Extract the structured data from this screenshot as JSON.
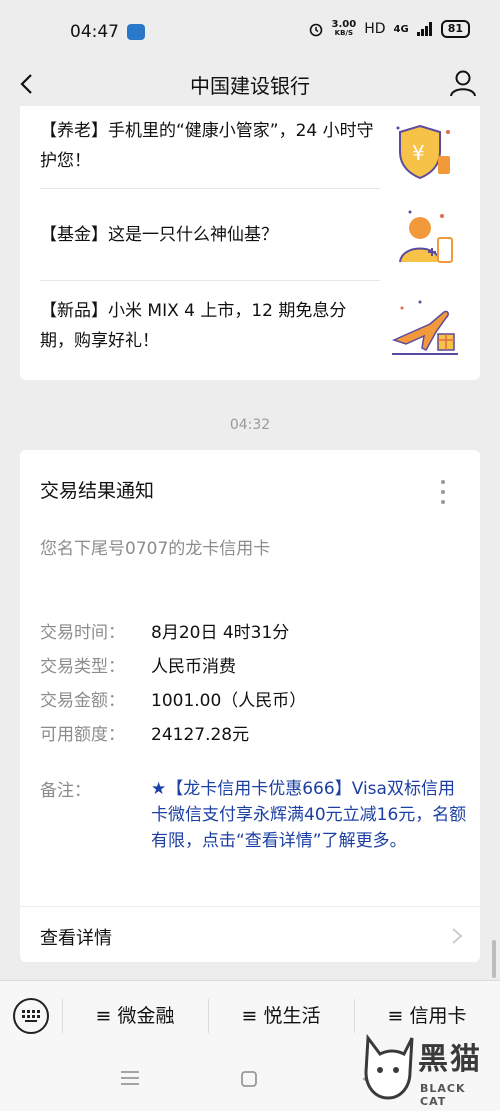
{
  "status_bar": {
    "time": "04:47",
    "speed": "3.00",
    "speed_unit": "KB/S",
    "hd": "HD",
    "network": "4G",
    "battery": "81"
  },
  "header": {
    "title": "中国建设银行"
  },
  "news": [
    {
      "text": "【养老】手机里的“健康小管家”，24 小时守护您！",
      "icon": "pension-shield-icon"
    },
    {
      "text": "【基金】这是一只什么神仙基？",
      "icon": "fund-person-icon"
    },
    {
      "text": "【新品】小米 MIX 4 上市，12 期免息分期，购享好礼！",
      "icon": "airplane-gift-icon"
    }
  ],
  "timestamp": "04:32",
  "notice": {
    "title": "交易结果通知",
    "subtitle": "您名下尾号0707的龙卡信用卡",
    "fields": [
      {
        "label": "交易时间：",
        "value": "8月20日 4时31分"
      },
      {
        "label": "交易类型：",
        "value": "人民币消费"
      },
      {
        "label": "交易金额：",
        "value": "1001.00（人民币）"
      },
      {
        "label": "可用额度：",
        "value": "24127.28元"
      }
    ],
    "remark_label": "备注：",
    "remark_text": "★【龙卡信用卡优惠666】Visa双标信用卡微信支付享永辉满40元立减16元，名额有限，点击“查看详情”了解更多。",
    "detail_label": "查看详情"
  },
  "menu": {
    "items": [
      "≡ 微金融",
      "≡ 悦生活",
      "≡ 信用卡"
    ]
  },
  "watermark": {
    "text": "黑猫",
    "sub": "BLACK CAT"
  },
  "colors": {
    "background": "#ededed",
    "link_blue": "#1c3fa3",
    "muted_gray": "#8c8c8c"
  }
}
